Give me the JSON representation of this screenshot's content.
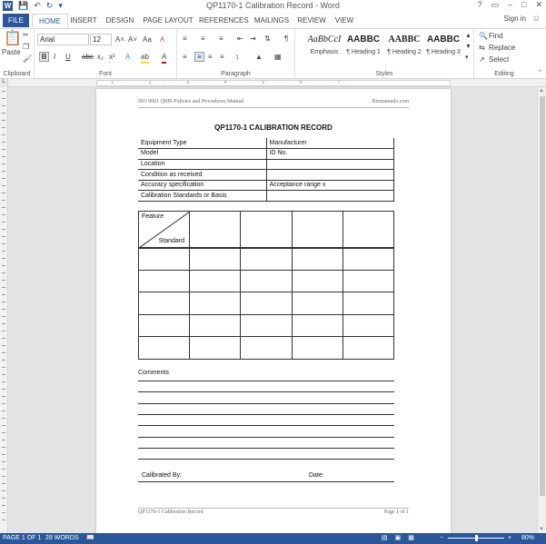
{
  "titlebar": {
    "doc_title": "QP1170-1 Calibration Record - Word",
    "app_logo": "W",
    "help": "?",
    "ribbon_display": "▭",
    "minimize": "–",
    "maximize": "□",
    "close": "✕"
  },
  "tabs": {
    "file": "FILE",
    "items": [
      {
        "label": "HOME",
        "active": true
      },
      {
        "label": "INSERT",
        "active": false
      },
      {
        "label": "DESIGN",
        "active": false
      },
      {
        "label": "PAGE LAYOUT",
        "active": false
      },
      {
        "label": "REFERENCES",
        "active": false
      },
      {
        "label": "MAILINGS",
        "active": false
      },
      {
        "label": "REVIEW",
        "active": false
      },
      {
        "label": "VIEW",
        "active": false
      }
    ],
    "sign_in": "Sign in"
  },
  "ribbon": {
    "clipboard": {
      "label": "Clipboard",
      "paste": "Paste"
    },
    "font": {
      "label": "Font",
      "font_name": "Arial",
      "font_size": "12",
      "grow": "A˄",
      "shrink": "A˅",
      "change_case": "Aa",
      "clear_format": "A",
      "bold": "B",
      "italic": "I",
      "underline": "U",
      "strike": "abc",
      "subscript": "x₂",
      "superscript": "x²",
      "text_effects": "A",
      "highlight": "ab",
      "font_color": "A"
    },
    "paragraph": {
      "label": "Paragraph",
      "pilcrow": "¶"
    },
    "styles": {
      "label": "Styles",
      "items": [
        {
          "sample": "AaBbCcI",
          "name": "Emphasis"
        },
        {
          "sample": "AABBC",
          "name": "¶ Heading 1"
        },
        {
          "sample": "AABBC",
          "name": "¶ Heading 2"
        },
        {
          "sample": "AABBC",
          "name": "¶ Heading 3"
        }
      ]
    },
    "editing": {
      "label": "Editing",
      "find": "Find",
      "replace": "Replace",
      "select": "Select"
    }
  },
  "document": {
    "header_left": "ISO 9001 QMS Policies and Procedures Manual",
    "header_right": "Bizmanualz.com",
    "title": "QP1170-1 CALIBRATION RECORD",
    "info_rows": [
      [
        "Equipment Type",
        "Manufacturer"
      ],
      [
        "Model",
        "ID No."
      ],
      [
        "Location",
        ""
      ],
      [
        "Condition as received",
        ""
      ],
      [
        "Accuracy specification",
        "Acceptance range  ±"
      ],
      [
        "Calibration Standards or Basis",
        ""
      ]
    ],
    "grid_feature": "Feature",
    "grid_standard": "Standard",
    "comments_label": "Comments",
    "calibrated_by": "Calibrated By:",
    "date": "Date:",
    "footer_left": "QP1170-1 Calibration Record",
    "footer_right": "Page 1 of 1"
  },
  "statusbar": {
    "page": "PAGE 1 OF 1",
    "words": "28 WORDS",
    "zoom": "80%",
    "zoom_level": 0.5
  }
}
